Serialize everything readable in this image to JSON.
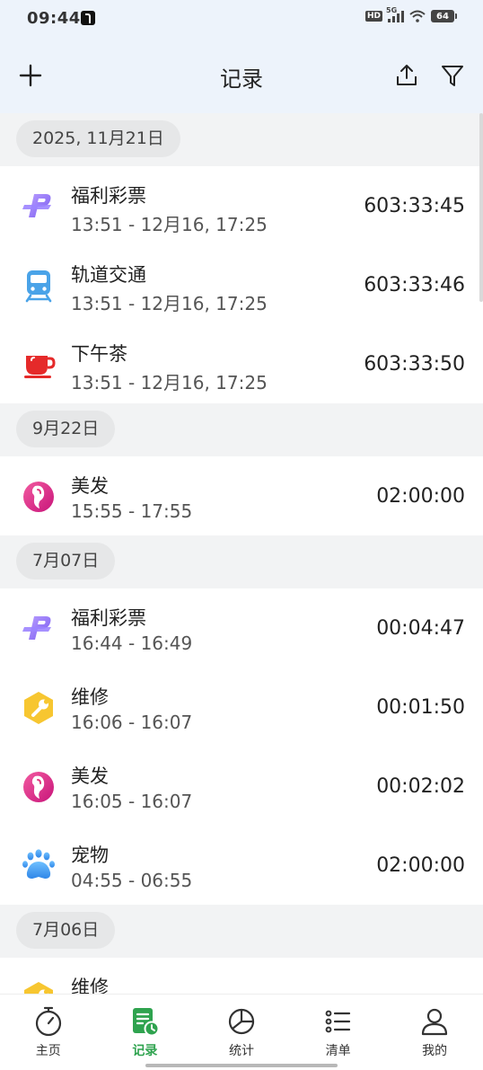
{
  "status": {
    "time": "09:44",
    "hd": "HD",
    "network": "5G",
    "battery": "64"
  },
  "header": {
    "title": "记录"
  },
  "sections": [
    {
      "date": "2025, 11月21日",
      "records": [
        {
          "icon": "lottery-icon",
          "name": "福利彩票",
          "range": "13:51 - 12月16, 17:25",
          "duration": "603:33:45"
        },
        {
          "icon": "train-icon",
          "name": "轨道交通",
          "range": "13:51 - 12月16, 17:25",
          "duration": "603:33:46"
        },
        {
          "icon": "teacup-icon",
          "name": "下午茶",
          "range": "13:51 - 12月16, 17:25",
          "duration": "603:33:50"
        }
      ]
    },
    {
      "date": "9月22日",
      "records": [
        {
          "icon": "hair-icon",
          "name": "美发",
          "range": "15:55 - 17:55",
          "duration": "02:00:00"
        }
      ]
    },
    {
      "date": "7月07日",
      "records": [
        {
          "icon": "lottery-icon",
          "name": "福利彩票",
          "range": "16:44 - 16:49",
          "duration": "00:04:47"
        },
        {
          "icon": "wrench-icon",
          "name": "维修",
          "range": "16:06 - 16:07",
          "duration": "00:01:50"
        },
        {
          "icon": "hair-icon",
          "name": "美发",
          "range": "16:05 - 16:07",
          "duration": "00:02:02"
        },
        {
          "icon": "paw-icon",
          "name": "宠物",
          "range": "04:55 - 06:55",
          "duration": "02:00:00"
        }
      ]
    },
    {
      "date": "7月06日",
      "records": [
        {
          "icon": "wrench-icon",
          "name": "维修",
          "range": "",
          "duration": ""
        }
      ]
    }
  ],
  "nav": [
    {
      "icon": "stopwatch-icon",
      "label": "主页"
    },
    {
      "icon": "record-icon",
      "label": "记录",
      "active": true
    },
    {
      "icon": "pie-chart-icon",
      "label": "统计"
    },
    {
      "icon": "list-icon",
      "label": "清单"
    },
    {
      "icon": "user-icon",
      "label": "我的"
    }
  ],
  "colors": {
    "accent": "#2fa34f",
    "header_bg": "#edf3fb",
    "section_bg": "#f2f3f4"
  }
}
